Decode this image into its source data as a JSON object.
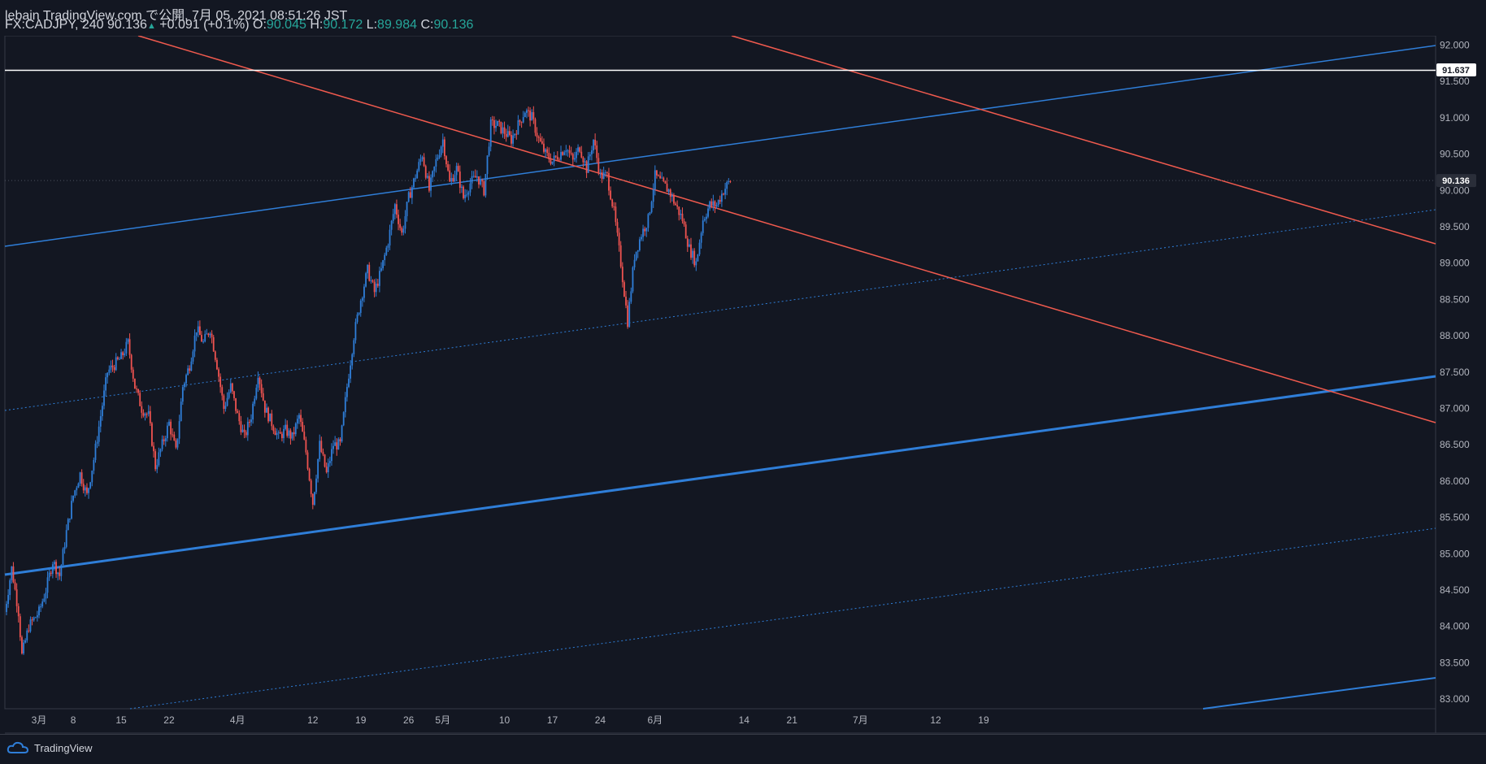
{
  "header": {
    "published_line": "lebain TradingView.com で公開, 7月 05, 2021 08:51:26 JST",
    "symbol": "FX:CADJPY, 240",
    "last": "90.136",
    "change": "+0.091 (+0.1%)",
    "open_label": "O:",
    "open": "90.045",
    "high_label": "H:",
    "high": "90.172",
    "low_label": "L:",
    "low": "89.984",
    "close_label": "C:",
    "close": "90.136"
  },
  "footer": {
    "brand": "TradingView"
  },
  "colors": {
    "background": "#131722",
    "up": "#2f7ed8",
    "down": "#ef5350",
    "trend_blue": "#2f7ed8",
    "trend_red": "#f05a4e",
    "level": "#ffffff"
  },
  "chart_data": {
    "type": "candlestick",
    "symbol": "FX:CADJPY",
    "interval": "240",
    "x_ticks": [
      "3月",
      "8",
      "15",
      "22",
      "4月",
      "12",
      "19",
      "26",
      "5月",
      "10",
      "17",
      "24",
      "6月",
      "14",
      "21",
      "7月",
      "12",
      "19"
    ],
    "x_tick_days": [
      0,
      5,
      12,
      19,
      29,
      40,
      47,
      54,
      59,
      68,
      75,
      82,
      90,
      103,
      110,
      120,
      131,
      138
    ],
    "ylim": [
      82.8,
      92.1
    ],
    "y_ticks": [
      "92.000",
      "91.500",
      "91.000",
      "90.500",
      "90.000",
      "89.500",
      "89.000",
      "88.500",
      "88.000",
      "87.500",
      "87.000",
      "86.500",
      "86.000",
      "85.500",
      "85.000",
      "84.500",
      "84.000",
      "83.500",
      "83.000"
    ],
    "y_tick_values": [
      92,
      91.5,
      91,
      90.5,
      90,
      89.5,
      89,
      88.5,
      88,
      87.5,
      87,
      86.5,
      86,
      85.5,
      85,
      84.5,
      84,
      83.5,
      83
    ],
    "current_price": "90.136",
    "level_price": "91.637",
    "close_path": [
      [
        -5,
        84.2
      ],
      [
        -4,
        84.8
      ],
      [
        -3,
        84.2
      ],
      [
        -2.5,
        83.6
      ],
      [
        -1.5,
        84.0
      ],
      [
        0,
        84.2
      ],
      [
        1,
        84.5
      ],
      [
        2,
        84.9
      ],
      [
        3,
        84.7
      ],
      [
        4,
        85.3
      ],
      [
        5,
        85.8
      ],
      [
        6,
        86.1
      ],
      [
        7,
        85.8
      ],
      [
        8,
        86.3
      ],
      [
        9,
        86.9
      ],
      [
        10,
        87.5
      ],
      [
        11,
        87.6
      ],
      [
        12,
        87.7
      ],
      [
        13,
        87.9
      ],
      [
        14,
        87.3
      ],
      [
        15,
        87.0
      ],
      [
        16,
        86.9
      ],
      [
        17,
        86.2
      ],
      [
        18,
        86.5
      ],
      [
        19,
        86.8
      ],
      [
        20,
        86.4
      ],
      [
        21,
        87.3
      ],
      [
        22,
        87.6
      ],
      [
        23,
        88.1
      ],
      [
        24,
        87.9
      ],
      [
        25,
        88.1
      ],
      [
        26,
        87.6
      ],
      [
        27,
        87.0
      ],
      [
        28,
        87.3
      ],
      [
        29,
        86.9
      ],
      [
        30,
        86.6
      ],
      [
        31,
        86.9
      ],
      [
        32,
        87.5
      ],
      [
        33,
        87.0
      ],
      [
        34,
        86.8
      ],
      [
        35,
        86.6
      ],
      [
        36,
        86.7
      ],
      [
        37,
        86.6
      ],
      [
        38,
        86.9
      ],
      [
        39,
        86.4
      ],
      [
        40,
        85.7
      ],
      [
        41,
        86.5
      ],
      [
        42,
        86.1
      ],
      [
        43,
        86.5
      ],
      [
        44,
        86.5
      ],
      [
        45,
        87.3
      ],
      [
        46,
        88.0
      ],
      [
        47,
        88.5
      ],
      [
        48,
        88.9
      ],
      [
        49,
        88.6
      ],
      [
        50,
        88.9
      ],
      [
        51,
        89.3
      ],
      [
        52,
        89.8
      ],
      [
        53,
        89.4
      ],
      [
        54,
        89.9
      ],
      [
        55,
        90.2
      ],
      [
        56,
        90.5
      ],
      [
        57,
        90.0
      ],
      [
        58,
        90.4
      ],
      [
        59,
        90.7
      ],
      [
        60,
        90.1
      ],
      [
        61,
        90.3
      ],
      [
        62,
        89.9
      ],
      [
        63,
        90.1
      ],
      [
        64,
        90.2
      ],
      [
        65,
        90.0
      ],
      [
        66,
        90.9
      ],
      [
        67,
        90.9
      ],
      [
        68,
        90.8
      ],
      [
        69,
        90.7
      ],
      [
        70,
        90.9
      ],
      [
        71,
        91.1
      ],
      [
        72,
        91.0
      ],
      [
        73,
        90.7
      ],
      [
        74,
        90.5
      ],
      [
        75,
        90.4
      ],
      [
        76,
        90.5
      ],
      [
        77,
        90.6
      ],
      [
        78,
        90.4
      ],
      [
        79,
        90.6
      ],
      [
        80,
        90.3
      ],
      [
        81,
        90.7
      ],
      [
        82,
        90.2
      ],
      [
        83,
        90.2
      ],
      [
        84,
        89.7
      ],
      [
        85,
        89.0
      ],
      [
        86,
        88.2
      ],
      [
        87,
        89.1
      ],
      [
        88,
        89.4
      ],
      [
        89,
        89.6
      ],
      [
        90,
        90.2
      ],
      [
        91,
        90.1
      ],
      [
        92,
        90.0
      ],
      [
        93,
        89.8
      ],
      [
        94,
        89.6
      ],
      [
        95,
        89.2
      ],
      [
        96,
        89.0
      ],
      [
        97,
        89.6
      ],
      [
        98,
        89.8
      ],
      [
        99,
        89.8
      ],
      [
        100,
        90.0
      ],
      [
        101,
        90.14
      ]
    ]
  }
}
